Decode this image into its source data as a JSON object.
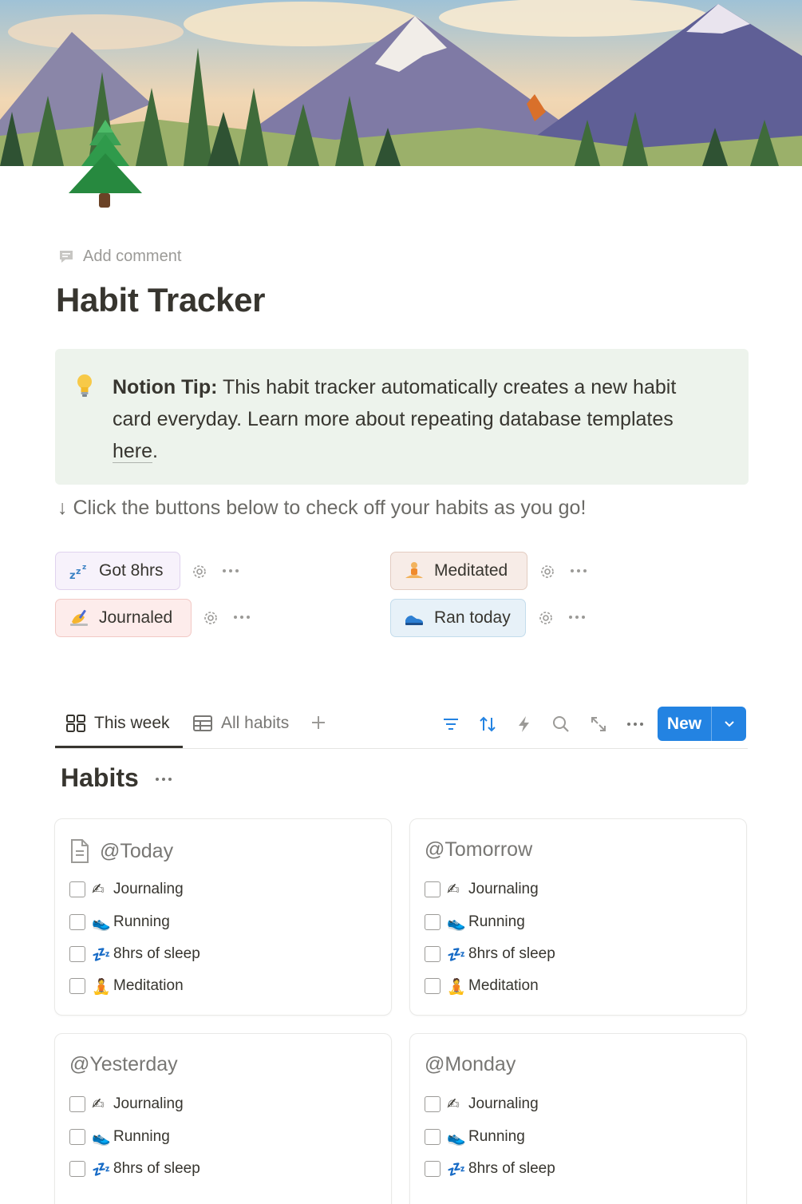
{
  "page": {
    "add_comment_label": "Add comment",
    "title": "Habit Tracker"
  },
  "callout": {
    "bold": "Notion Tip:",
    "text": " This habit tracker automatically creates a new habit card everyday. Learn more about repeating database templates ",
    "link": "here",
    "end": "."
  },
  "hint": "↓ Click the buttons below to check off your habits as you go!",
  "buttons": [
    {
      "label": "Got 8hrs",
      "icon": "zzz-icon"
    },
    {
      "label": "Journaled",
      "icon": "writing-hand-icon"
    },
    {
      "label": "Meditated",
      "icon": "meditation-icon"
    },
    {
      "label": "Ran today",
      "icon": "running-shoe-icon"
    }
  ],
  "views": {
    "tabs": [
      {
        "label": "This week",
        "icon": "board-icon"
      },
      {
        "label": "All habits",
        "icon": "table-icon"
      }
    ],
    "new_label": "New",
    "accent": "#2383e2"
  },
  "group": {
    "title": "Habits"
  },
  "cards": [
    {
      "title": "@Today",
      "items": [
        "Journaling",
        "Running",
        "8hrs of sleep",
        "Meditation"
      ]
    },
    {
      "title": "@Tomorrow",
      "items": [
        "Journaling",
        "Running",
        "8hrs of sleep",
        "Meditation"
      ]
    },
    {
      "title": "@Yesterday",
      "items": [
        "Journaling",
        "Running",
        "8hrs of sleep"
      ]
    },
    {
      "title": "@Monday",
      "items": [
        "Journaling",
        "Running",
        "8hrs of sleep"
      ]
    }
  ],
  "colors": {
    "callout_bg": "#edf3ec",
    "text": "#37352f",
    "muted": "#787774"
  }
}
